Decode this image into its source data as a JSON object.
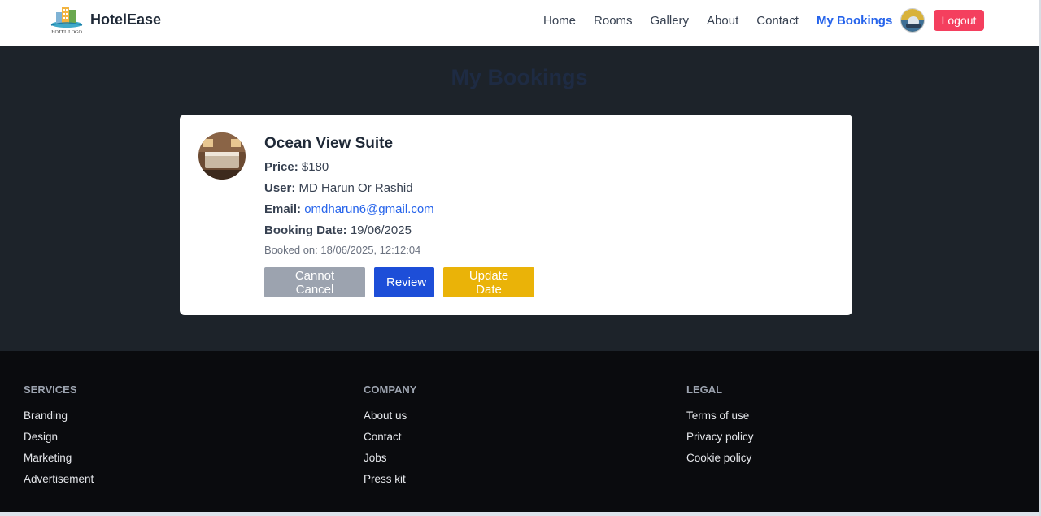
{
  "navbar": {
    "brand": "HotelEase",
    "logo_text": "HOTEL LOGO",
    "links": [
      "Home",
      "Rooms",
      "Gallery",
      "About",
      "Contact",
      "My Bookings"
    ],
    "active": "My Bookings",
    "logout_label": "Logout"
  },
  "main": {
    "title": "My Bookings",
    "booking": {
      "room_name": "Ocean View Suite",
      "price_label": "Price:",
      "price": "$180",
      "user_label": "User:",
      "user": "MD Harun Or Rashid",
      "email_label": "Email:",
      "email": "omdharun6@gmail.com",
      "date_label": "Booking Date:",
      "date": "19/06/2025",
      "booked_on": "Booked on: 18/06/2025, 12:12:04",
      "cancel_label": "Cannot Cancel",
      "review_label": "Review",
      "update_label": "Update Date"
    }
  },
  "footer": {
    "services": {
      "title": "Services",
      "links": [
        "Branding",
        "Design",
        "Marketing",
        "Advertisement"
      ]
    },
    "company": {
      "title": "Company",
      "links": [
        "About us",
        "Contact",
        "Jobs",
        "Press kit"
      ]
    },
    "legal": {
      "title": "Legal",
      "links": [
        "Terms of use",
        "Privacy policy",
        "Cookie policy"
      ]
    }
  },
  "colors": {
    "accent": "#2563eb",
    "logout": "#f43f5e",
    "review": "#1d4ed8",
    "update": "#eab308",
    "disabled": "#9ca3af",
    "page_bg": "#1d232a",
    "footer_bg": "#0a0b0e"
  }
}
